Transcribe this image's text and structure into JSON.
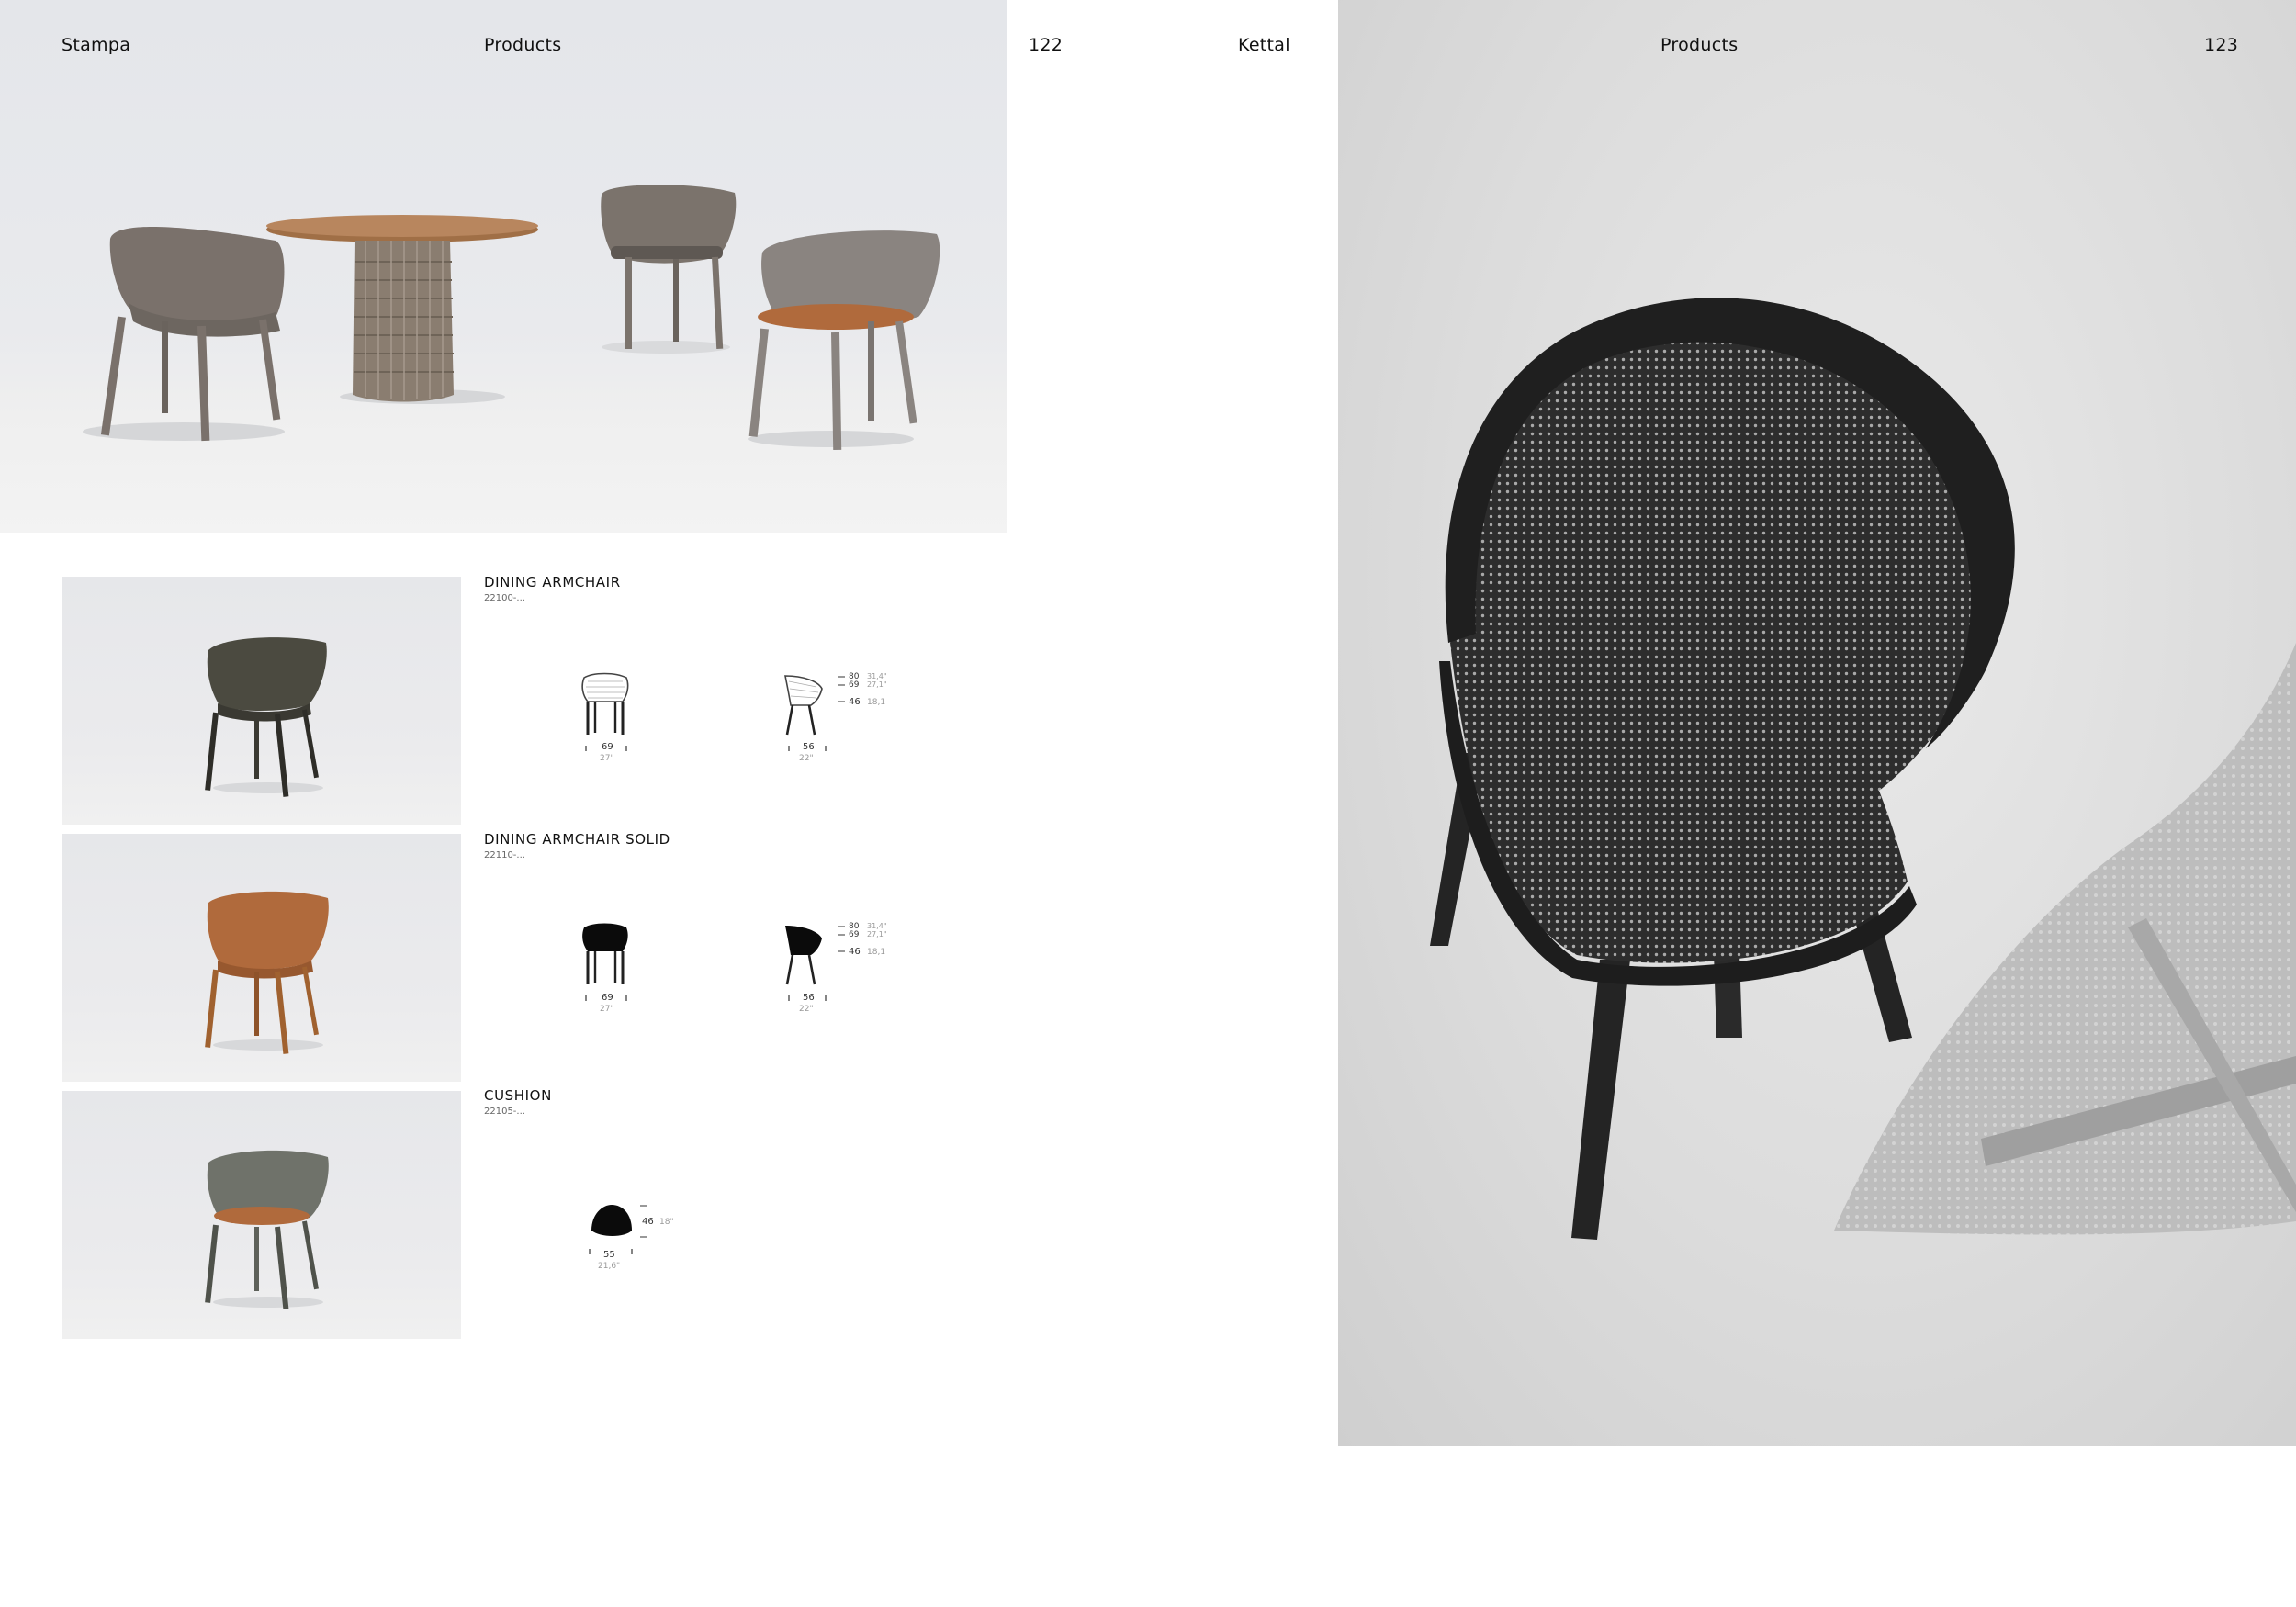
{
  "header": {
    "left_title": "Stampa",
    "left_section": "Products",
    "left_page": "122",
    "brand": "Kettal",
    "right_section": "Products",
    "right_page": "123"
  },
  "products": [
    {
      "name": "DINING ARMCHAIR",
      "code": "22100-...",
      "width_cm": "69",
      "width_in": "27\"",
      "depth_cm": "56",
      "depth_in": "22\"",
      "height_cm": "80",
      "height_in": "31,4\"",
      "arm_cm": "69",
      "arm_in": "27,1\"",
      "seat_cm": "46",
      "seat_in": "18,1"
    },
    {
      "name": "DINING ARMCHAIR SOLID",
      "code": "22110-...",
      "width_cm": "69",
      "width_in": "27\"",
      "depth_cm": "56",
      "depth_in": "22\"",
      "height_cm": "80",
      "height_in": "31,4\"",
      "arm_cm": "69",
      "arm_in": "27,1\"",
      "seat_cm": "46",
      "seat_in": "18,1"
    },
    {
      "name": "CUSHION",
      "code": "22105-...",
      "width_cm": "55",
      "width_in": "21,6\"",
      "height_cm": "46",
      "height_in": "18\""
    }
  ],
  "colors": {
    "chair_taupe": "#7a716b",
    "chair_olive": "#4b4a40",
    "chair_terracotta": "#b06a3c",
    "chair_grey_green": "#6f726a",
    "table_top": "#b8865e",
    "chair_black": "#2c2c2c"
  }
}
